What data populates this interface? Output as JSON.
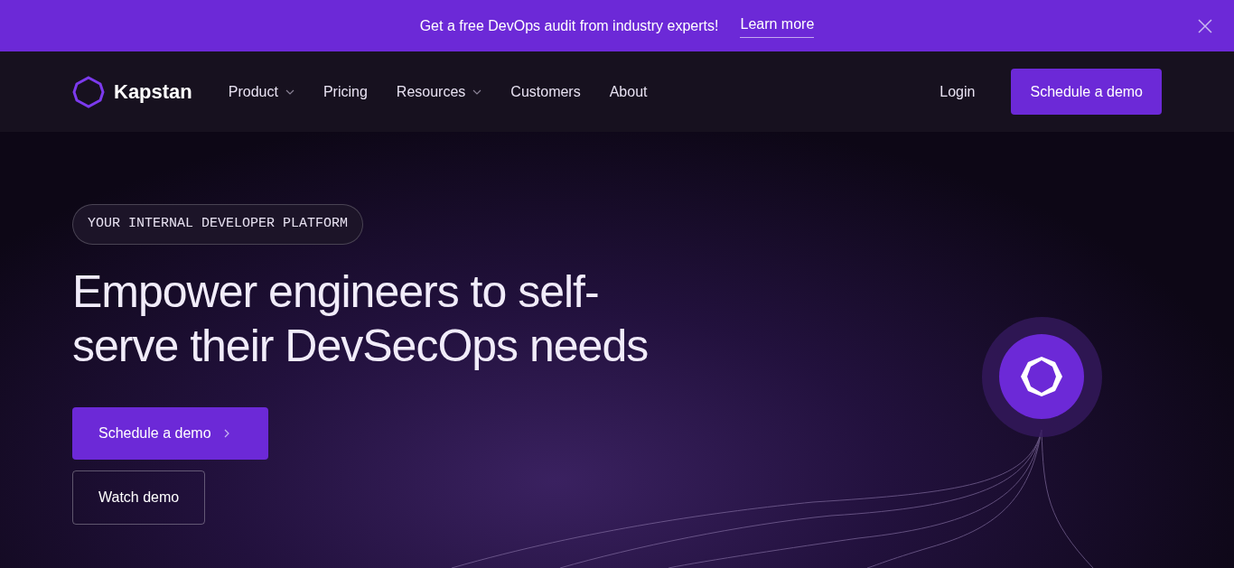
{
  "banner": {
    "text": "Get a free DevOps audit from industry experts!",
    "link": "Learn more"
  },
  "nav": {
    "brand": "Kapstan",
    "items": [
      {
        "label": "Product",
        "has_menu": true
      },
      {
        "label": "Pricing",
        "has_menu": false
      },
      {
        "label": "Resources",
        "has_menu": true
      },
      {
        "label": "Customers",
        "has_menu": false
      },
      {
        "label": "About",
        "has_menu": false
      }
    ],
    "login": "Login",
    "cta": "Schedule a demo"
  },
  "hero": {
    "eyebrow": "YOUR INTERNAL DEVELOPER PLATFORM",
    "headline": "Empower engineers to self-serve their DevSecOps needs",
    "primary_button": "Schedule a demo",
    "secondary_button": "Watch demo"
  }
}
